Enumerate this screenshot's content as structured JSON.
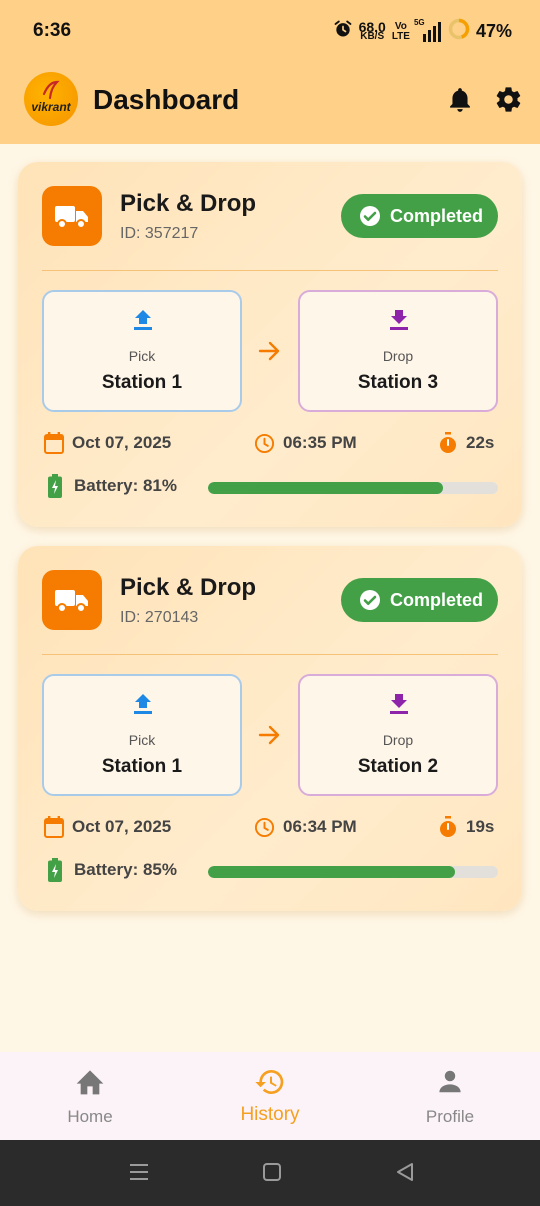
{
  "status_bar": {
    "time": "6:36",
    "net_speed": "68.0",
    "net_unit": "KB/S",
    "volte_top": "Vo",
    "volte_bottom": "LTE",
    "signal": "5G",
    "battery": "47%"
  },
  "app_bar": {
    "logo_text": "vikrant",
    "title": "Dashboard"
  },
  "cards": [
    {
      "title": "Pick & Drop",
      "id": "ID: 357217",
      "status": "Completed",
      "pick": {
        "label": "Pick",
        "station": "Station 1"
      },
      "drop": {
        "label": "Drop",
        "station": "Station 3"
      },
      "date": "Oct 07, 2025",
      "time": "06:35 PM",
      "duration": "22s",
      "battery_text": "Battery: 81%",
      "battery_level": 0.81
    },
    {
      "title": "Pick & Drop",
      "id": "ID: 270143",
      "status": "Completed",
      "pick": {
        "label": "Pick",
        "station": "Station 1"
      },
      "drop": {
        "label": "Drop",
        "station": "Station 2"
      },
      "date": "Oct 07, 2025",
      "time": "06:34 PM",
      "duration": "19s",
      "battery_text": "Battery: 85%",
      "battery_level": 0.85
    }
  ],
  "bottom_nav": {
    "items": [
      {
        "label": "Home",
        "icon": "home-icon"
      },
      {
        "label": "History",
        "icon": "history-icon"
      },
      {
        "label": "Profile",
        "icon": "person-icon"
      }
    ],
    "active": "History"
  },
  "colors": {
    "accent": "#f57c00",
    "success": "#43a047",
    "app_bar": "#ffd088",
    "pick_icon": "#1e88e5",
    "drop_icon": "#8e24aa"
  }
}
